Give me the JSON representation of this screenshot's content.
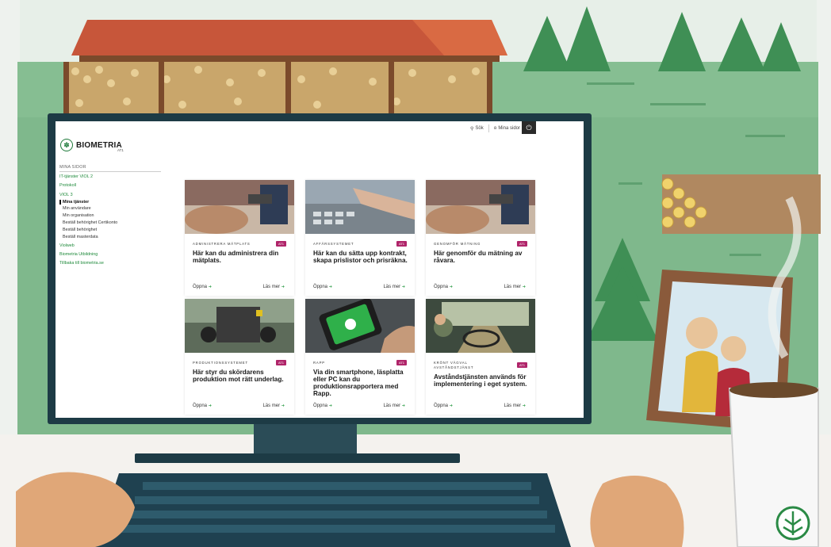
{
  "brand": {
    "name": "BIOMETRIA",
    "sub": "AT1"
  },
  "topbar": {
    "search_label": "Sök",
    "my_pages_label": "Mina sidor",
    "theme_icon": "power-icon"
  },
  "sidebar": {
    "heading": "MINA SIDOR",
    "items": [
      {
        "label": "IT-tjänster VIOL 2",
        "level": 0
      },
      {
        "label": "Protokoll",
        "level": 0
      },
      {
        "label": "VIOL 3",
        "level": 0
      },
      {
        "label": "Mina tjänster",
        "level": 1,
        "active": true
      },
      {
        "label": "Min användare",
        "level": 1
      },
      {
        "label": "Min organisation",
        "level": 1
      },
      {
        "label": "Beställ behörighet Certikonto",
        "level": 1
      },
      {
        "label": "Beställ behörighet",
        "level": 1
      },
      {
        "label": "Beställ masterdata",
        "level": 1
      },
      {
        "label": "Violweb",
        "level": 0
      },
      {
        "label": "Biometria Utbildning",
        "level": 0
      },
      {
        "label": "Tillbaka till biometria.se",
        "level": 0
      }
    ]
  },
  "cards": [
    {
      "category": "ADMINISTRERA MÄTPLATS",
      "tag": "AT1",
      "title": "Här kan du administrera din mätplats.",
      "open": "Öppna",
      "more": "Läs mer"
    },
    {
      "category": "AFFÄRSSYSTEMET",
      "tag": "AT1",
      "title": "Här kan du sätta upp kontrakt, skapa prislistor och prisräkna.",
      "open": "Öppna",
      "more": "Läs mer"
    },
    {
      "category": "GENOMFÖR MÄTNING",
      "tag": "AT1",
      "title": "Här genomför du mätning av råvara.",
      "open": "Öppna",
      "more": "Läs mer"
    },
    {
      "category": "PRODUKTIONSSYSTEMET",
      "tag": "AT1",
      "title": "Här styr du skördarens produktion mot rätt underlag.",
      "open": "Öppna",
      "more": "Läs mer"
    },
    {
      "category": "RAPP",
      "tag": "AT1",
      "title": "Via din smartphone, läsplatta eller PC kan du produktionsrapportera med Rapp.",
      "open": "Öppna",
      "more": "Läs mer"
    },
    {
      "category": "KRÖNT VÄGVAL AVSTÅNDSTJÄNST",
      "tag": "AT1",
      "title": "Avståndstjänsten används för implementering i eget system.",
      "open": "Öppna",
      "more": "Läs mer"
    }
  ],
  "colors": {
    "brand_green": "#1f7a3b",
    "tag_magenta": "#b0256a",
    "monitor": "#1d3b45"
  }
}
